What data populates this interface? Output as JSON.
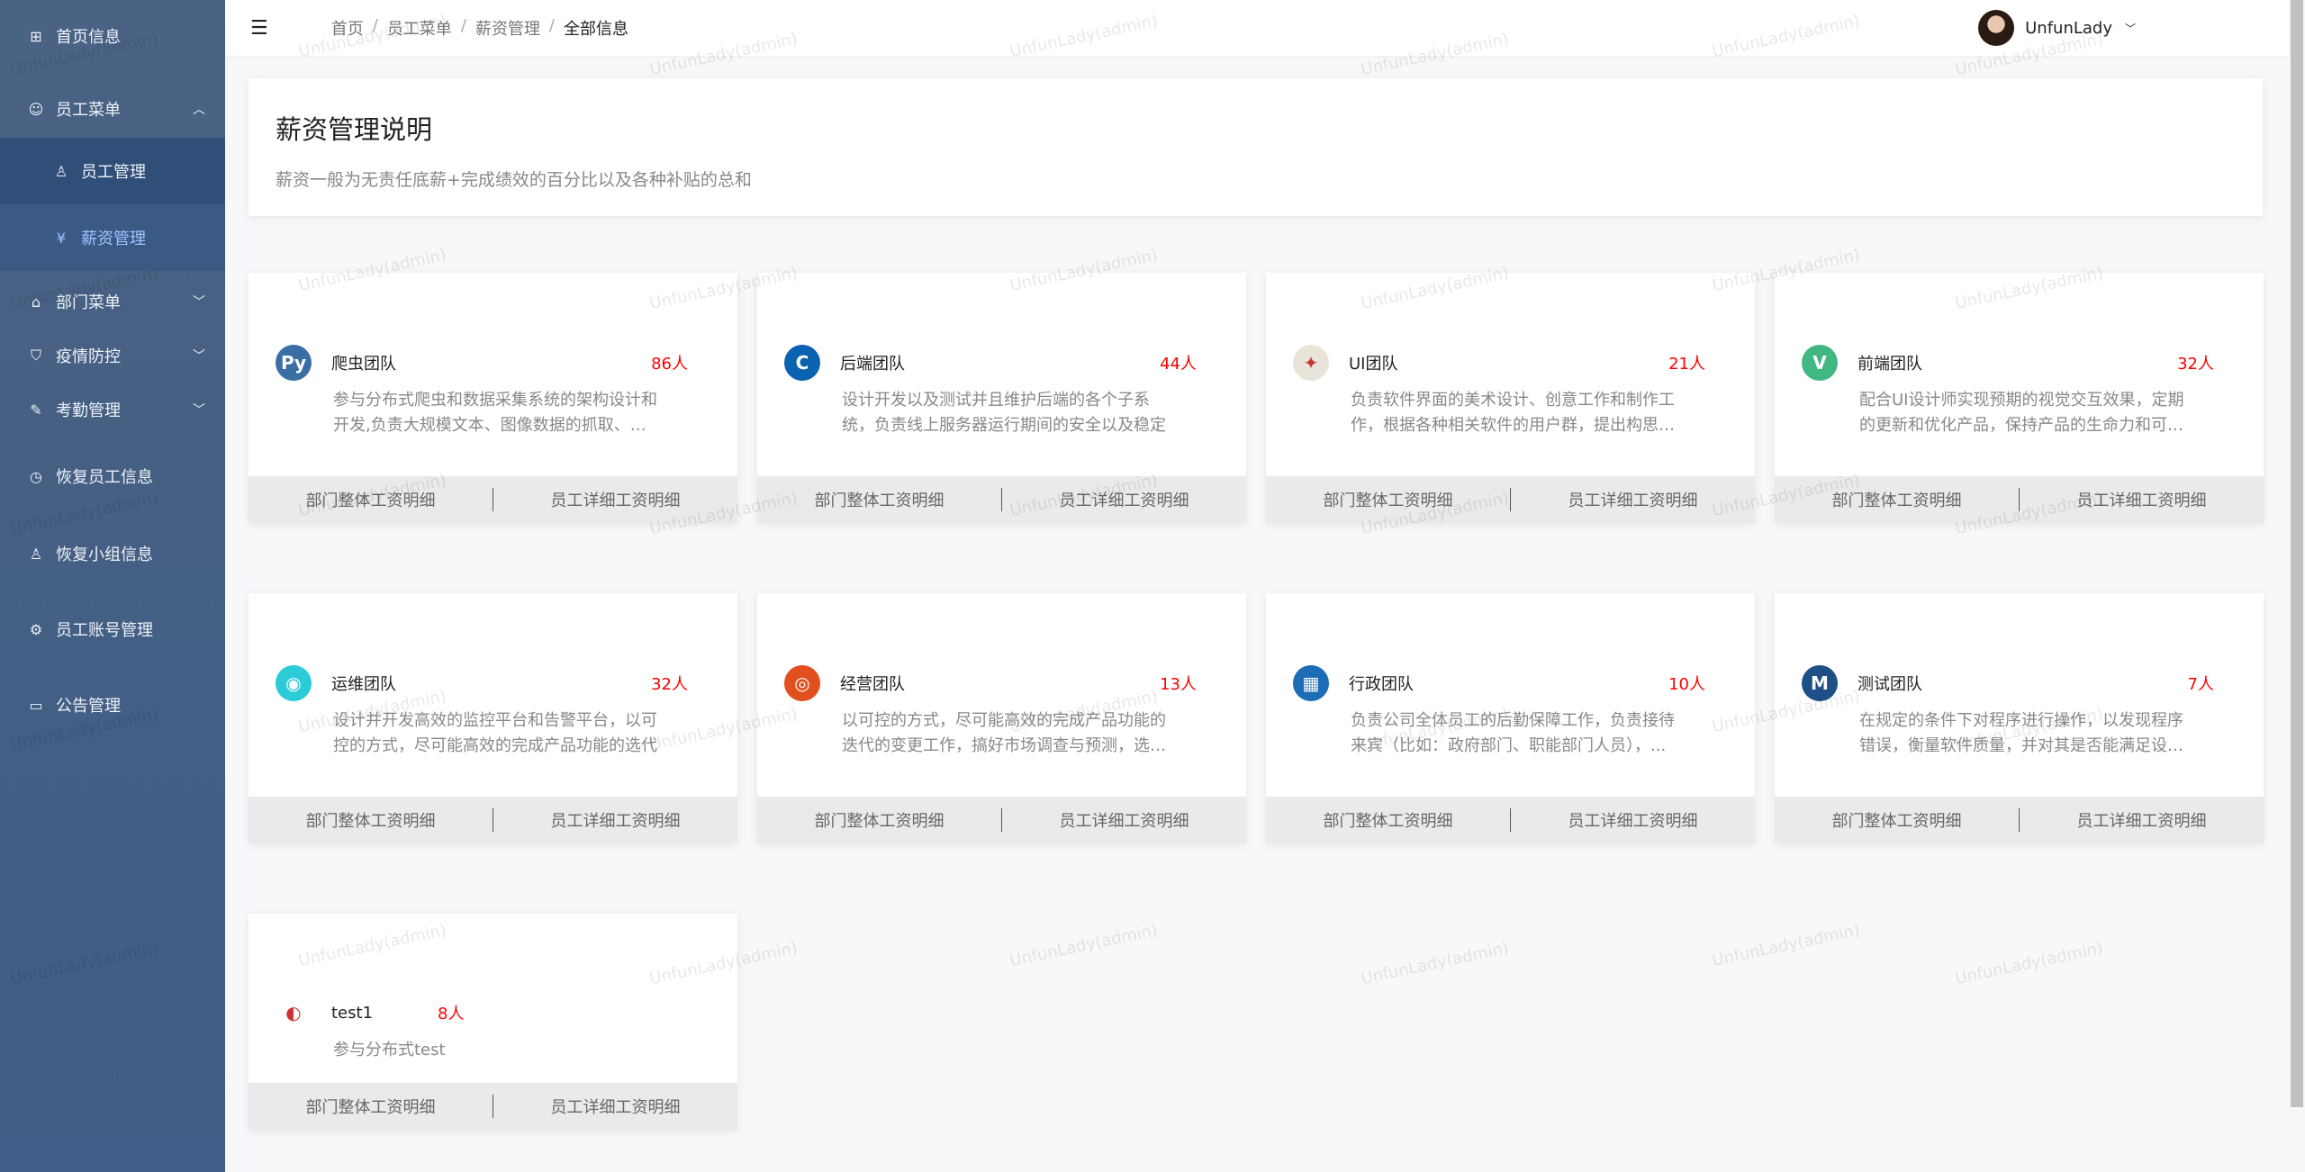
{
  "watermark": "UnfunLady(admin)",
  "sidebar": {
    "items": [
      {
        "label": "首页信息",
        "icon": "grid-icon"
      },
      {
        "label": "员工菜单",
        "icon": "users-icon",
        "expanded": true,
        "children": [
          {
            "label": "员工管理",
            "icon": "user-icon"
          },
          {
            "label": "薪资管理",
            "icon": "salary-icon",
            "active": true
          }
        ]
      },
      {
        "label": "部门菜单",
        "icon": "home-icon"
      },
      {
        "label": "疫情防控",
        "icon": "shield-icon"
      },
      {
        "label": "考勤管理",
        "icon": "stamp-icon"
      },
      {
        "label": "恢复员工信息",
        "icon": "clock-icon"
      },
      {
        "label": "恢复小组信息",
        "icon": "user-icon"
      },
      {
        "label": "员工账号管理",
        "icon": "gear-icon"
      },
      {
        "label": "公告管理",
        "icon": "monitor-icon"
      }
    ]
  },
  "header": {
    "breadcrumb": [
      "首页",
      "员工菜单",
      "薪资管理",
      "全部信息"
    ],
    "user": "UnfunLady"
  },
  "desc": {
    "title": "薪资管理说明",
    "text": "薪资一般为无责任底薪+完成绩效的百分比以及各种补贴的总和"
  },
  "footer": {
    "dept": "部门整体工资明细",
    "emp": "员工详细工资明细"
  },
  "teams": [
    {
      "name": "爬虫团队",
      "count": "86人",
      "text": "参与分布式爬虫和数据采集系统的架构设计和开发,负责大规模文本、图像数据的抓取、抽取，去重、分类等工作",
      "color": "#3a6ea5",
      "glyph": "Py"
    },
    {
      "name": "后端团队",
      "count": "44人",
      "text": "设计开发以及测试并且维护后端的各个子系统，负责线上服务器运行期间的安全以及稳定",
      "color": "#0b62b0",
      "glyph": "C"
    },
    {
      "name": "UI团队",
      "count": "21人",
      "text": "负责软件界面的美术设计、创意工作和制作工作，根据各种相关软件的用户群，提出构思新颖的设计方案",
      "color": "#e9e4da",
      "glyph": "✦"
    },
    {
      "name": "前端团队",
      "count": "32人",
      "text": "配合UI设计师实现预期的视觉交互效果，定期的更新和优化产品，保持产品的生命力和可用性",
      "color": "#41b883",
      "glyph": "V"
    },
    {
      "name": "运维团队",
      "count": "32人",
      "text": "设计并开发高效的监控平台和告警平台，以可控的方式，尽可能高效的完成产品功能的选代",
      "color": "#2ccbd8",
      "glyph": "◉"
    },
    {
      "name": "经营团队",
      "count": "13人",
      "text": "以可控的方式，尽可能高效的完成产品功能的迭代的变更工作，搞好市场调查与预测，选择好经营方向",
      "color": "#e2501f",
      "glyph": "◎"
    },
    {
      "name": "行政团队",
      "count": "10人",
      "text": "负责公司全体员工的后勤保障工作，负责接待来宾（比如：政府部门、职能部门人员），...",
      "color": "#1c6db5",
      "glyph": "▦"
    },
    {
      "name": "测试团队",
      "count": "7人",
      "text": "在规定的条件下对程序进行操作，以发现程序错误，衡量软件质量，并对其是否能满足设计要求进行评估",
      "color": "#1e4f86",
      "glyph": "M"
    },
    {
      "name": "test1",
      "count": "8人",
      "text": "参与分布式test",
      "color": "#ffffff",
      "glyph": "◐"
    }
  ]
}
